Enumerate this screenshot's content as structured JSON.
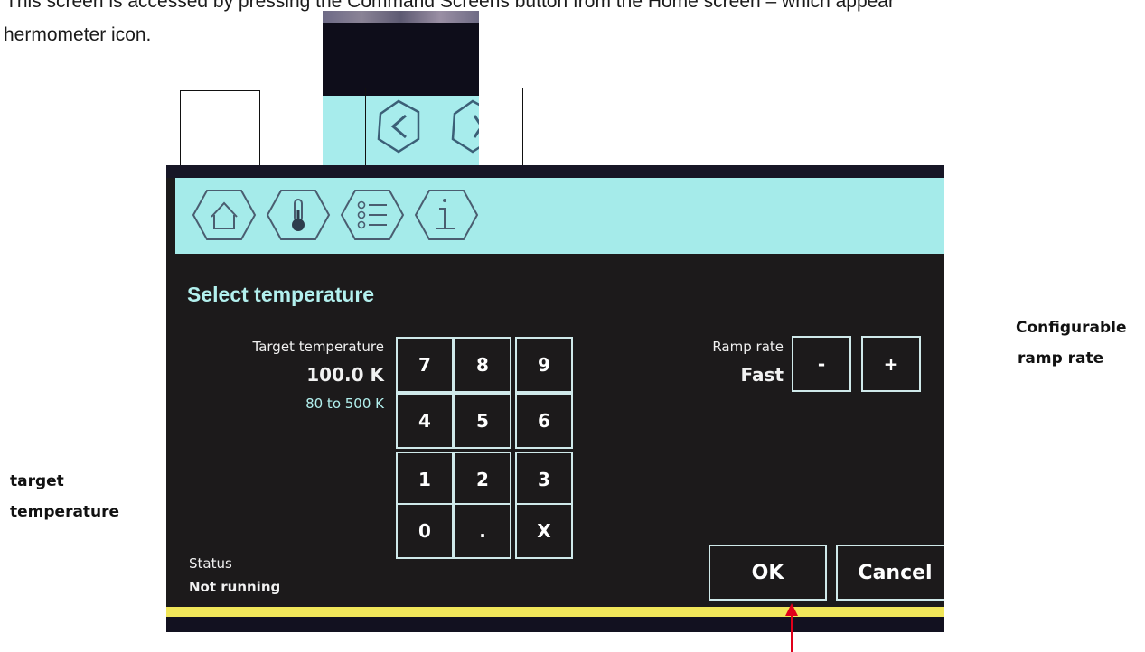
{
  "intro": {
    "line1": "This screen is accessed by pressing the Command Screens button from the Home screen – which appear",
    "line2": "hermometer icon."
  },
  "toolbar": {
    "buttons": [
      {
        "label": "Home",
        "icon": "house-icon"
      },
      {
        "label": "Command screens",
        "icon": "thermometer-icon"
      },
      {
        "label": "Menu",
        "icon": "list-icon"
      },
      {
        "label": "Info",
        "icon": "info-icon"
      }
    ]
  },
  "inset": {
    "icons": [
      "chevron-left-icon",
      "chevron-right-icon"
    ]
  },
  "screen": {
    "title": "Select temperature",
    "target": {
      "label": "Target temperature",
      "value": "100.0 K",
      "range": "80 to 500 K"
    },
    "keypad": [
      "7",
      "8",
      "9",
      "4",
      "5",
      "6",
      "1",
      "2",
      "3",
      "0",
      ".",
      "X"
    ],
    "ramp": {
      "label": "Ramp rate",
      "value": "Fast",
      "minus": "-",
      "plus": "+"
    },
    "status": {
      "label": "Status",
      "value": "Not running"
    },
    "ok": "OK",
    "cancel": "Cancel"
  },
  "annotations": {
    "right_line1": "Configurable",
    "right_line2": "ramp rate",
    "left_line1": "target",
    "left_line2": "temperature"
  },
  "colors": {
    "toolbar_bg": "#a5ebea",
    "screen_bg": "#1c1a1b",
    "title_text": "#b2f0ee",
    "status_bar": "#f1e65a",
    "arrow": "#e0001a"
  }
}
